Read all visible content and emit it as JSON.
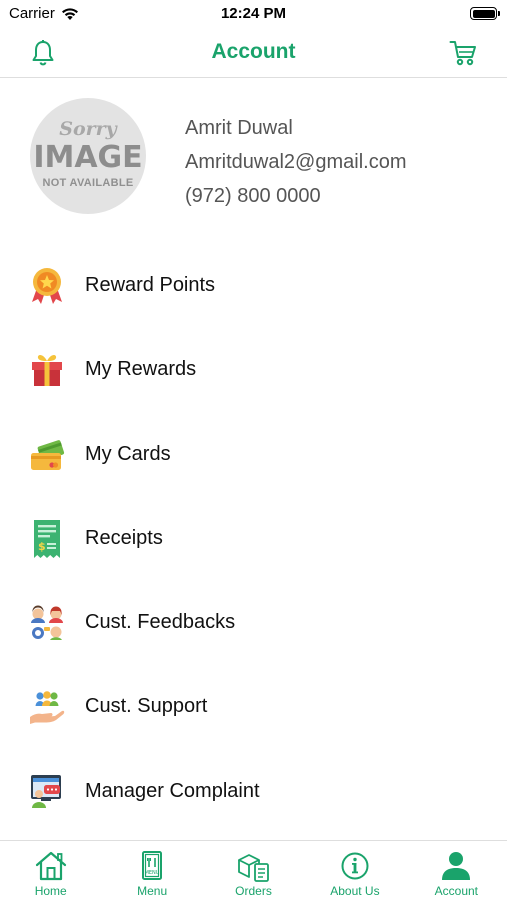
{
  "status_bar": {
    "carrier": "Carrier",
    "time": "12:24 PM"
  },
  "nav": {
    "title": "Account",
    "left_icon": "bell-icon",
    "right_icon": "cart-icon",
    "accent_color": "#1aa36b"
  },
  "profile": {
    "avatar_placeholder": {
      "line1": "Sorry",
      "line2": "IMAGE",
      "line3": "NOT AVAILABLE"
    },
    "name": "Amrit Duwal",
    "email": "Amritduwal2@gmail.com",
    "phone": "(972) 800 0000"
  },
  "menu": {
    "items": [
      {
        "label": "Reward Points",
        "icon": "medal-icon"
      },
      {
        "label": "My Rewards",
        "icon": "gift-icon"
      },
      {
        "label": "My Cards",
        "icon": "cards-icon"
      },
      {
        "label": "Receipts",
        "icon": "receipt-icon"
      },
      {
        "label": "Cust. Feedbacks",
        "icon": "feedback-icon"
      },
      {
        "label": "Cust. Support",
        "icon": "support-icon"
      },
      {
        "label": "Manager Complaint",
        "icon": "complaint-icon"
      }
    ]
  },
  "tabs": [
    {
      "label": "Home",
      "icon": "home-icon"
    },
    {
      "label": "Menu",
      "icon": "menu-icon"
    },
    {
      "label": "Orders",
      "icon": "orders-icon"
    },
    {
      "label": "About Us",
      "icon": "info-icon"
    },
    {
      "label": "Account",
      "icon": "person-icon",
      "selected": true
    }
  ]
}
